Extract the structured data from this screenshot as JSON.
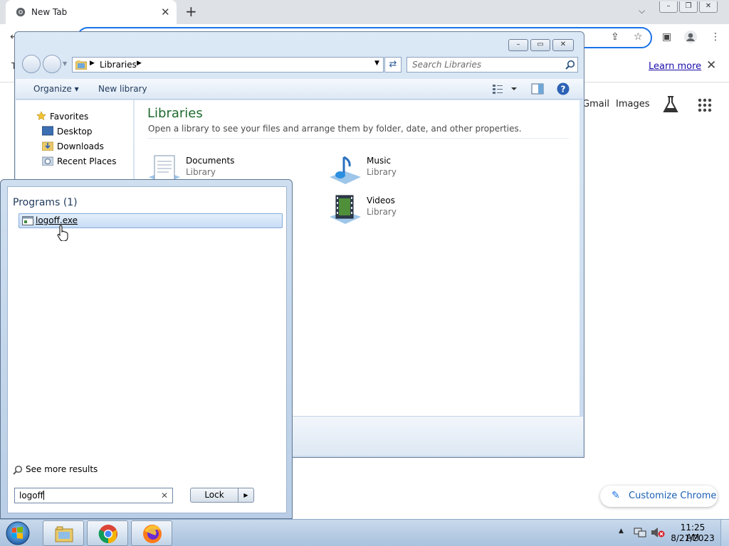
{
  "chrome": {
    "tab_title": "New Tab",
    "tab_close": "✕",
    "new_tab": "+",
    "infobar_prefix": "T",
    "learn_more": "Learn more",
    "infobar_close": "✕",
    "gmail": "Gmail",
    "images": "Images",
    "customize": "Customize Chrome"
  },
  "explorer": {
    "address_path": "Libraries",
    "search_placeholder": "Search Libraries",
    "organize": "Organize",
    "new_library": "New library",
    "nav": {
      "favorites": "Favorites",
      "items": [
        "Desktop",
        "Downloads",
        "Recent Places"
      ]
    },
    "title": "Libraries",
    "subtitle": "Open a library to see your files and arrange them by folder, date, and other properties.",
    "libraries": [
      {
        "name": "Documents",
        "type": "Library",
        "icon": "documents-library-icon"
      },
      {
        "name": "Music",
        "type": "Library",
        "icon": "music-library-icon"
      },
      {
        "name": "Videos",
        "type": "Library",
        "icon": "videos-library-icon"
      }
    ]
  },
  "startmenu": {
    "programs_header": "Programs (1)",
    "result": "logoff.exe",
    "see_more": "See more results",
    "search_value": "logoff",
    "clear": "✕",
    "lock": "Lock",
    "lock_arrow": "▶"
  },
  "taskbar": {
    "apps": [
      "explorer-icon",
      "chrome-icon",
      "firefox-icon"
    ],
    "time": "11:25 AM",
    "date": "8/21/2023"
  },
  "colors": {
    "chrome_accent": "#1a73e8",
    "library_title": "#1e6a2e",
    "selection": "#c9ddf5"
  }
}
